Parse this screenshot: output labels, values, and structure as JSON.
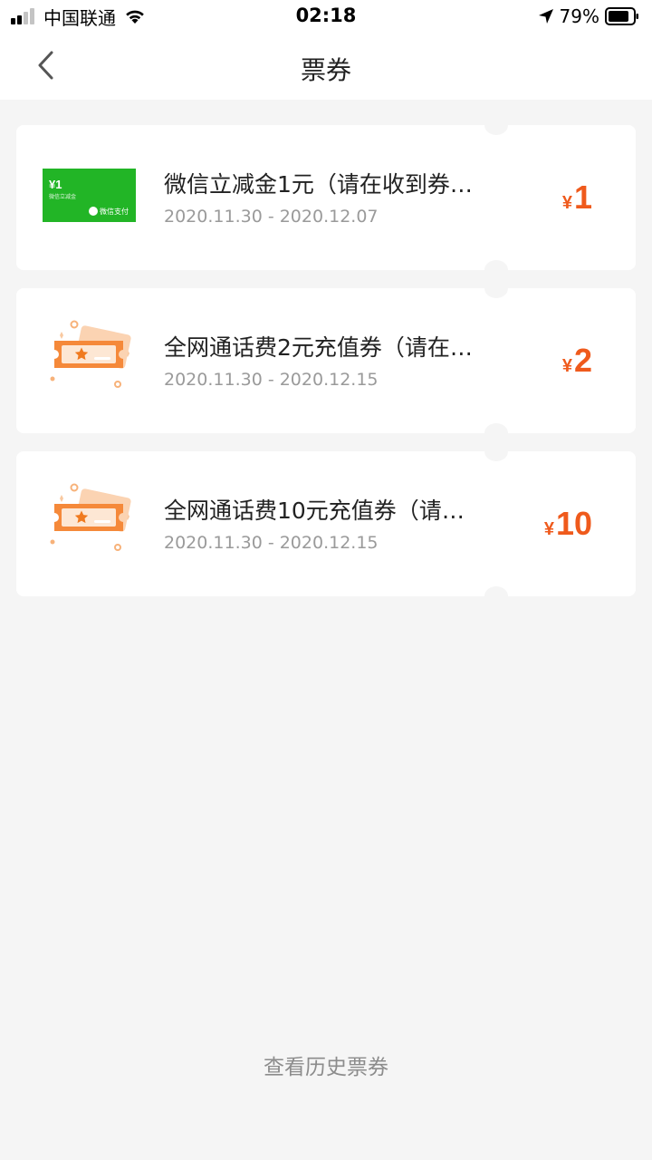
{
  "status_bar": {
    "carrier": "中国联通",
    "time": "02:18",
    "battery": "79%"
  },
  "nav": {
    "title": "票券"
  },
  "coupons": [
    {
      "title": "微信立减金1元（请在收到券…",
      "date": "2020.11.30 - 2020.12.07",
      "currency": "¥",
      "amount": "1",
      "thumb": "wechat-pay-card-icon",
      "thumb_value": "¥1",
      "thumb_label": "微信立减金",
      "thumb_brand": "微信支付"
    },
    {
      "title": "全网通话费2元充值券（请在…",
      "date": "2020.11.30 - 2020.12.15",
      "currency": "¥",
      "amount": "2",
      "thumb": "ticket-star-icon"
    },
    {
      "title": "全网通话费10元充值券（请…",
      "date": "2020.11.30 - 2020.12.15",
      "currency": "¥",
      "amount": "10",
      "thumb": "ticket-star-icon"
    }
  ],
  "footer": {
    "history_label": "查看历史票券"
  },
  "colors": {
    "accent": "#ef5a1c",
    "wechat_green": "#22b526",
    "ticket_orange": "#f5893a",
    "background": "#f5f5f5"
  }
}
